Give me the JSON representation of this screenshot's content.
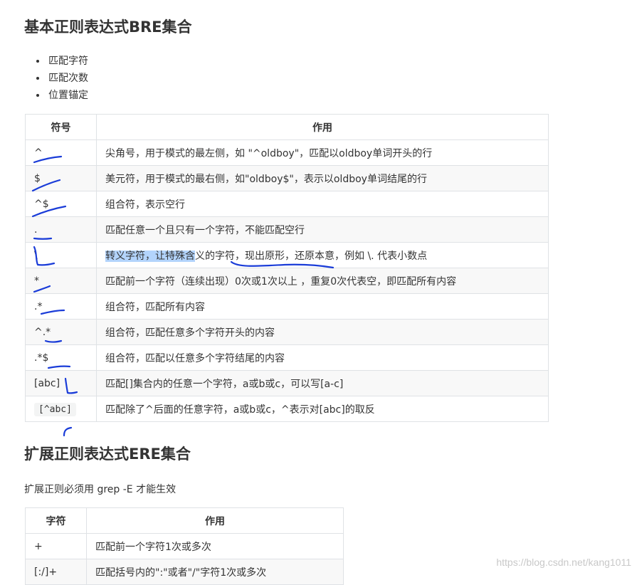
{
  "bre": {
    "title": "基本正则表达式BRE集合",
    "bullets": [
      "匹配字符",
      "匹配次数",
      "位置锚定"
    ],
    "headers": [
      "符号",
      "作用"
    ],
    "rows": [
      {
        "symbol": "^",
        "desc": "尖角号，用于模式的最左侧，如 \"^oldboy\"，匹配以oldboy单词开头的行"
      },
      {
        "symbol": "$",
        "desc": "美元符，用于模式的最右侧，如\"oldboy$\"，表示以oldboy单词结尾的行"
      },
      {
        "symbol": "^$",
        "desc": "组合符，表示空行"
      },
      {
        "symbol": ".",
        "desc": "匹配任意一个且只有一个字符，不能匹配空行"
      },
      {
        "symbol": "\\",
        "desc_highlight": "转义字符，让特殊含",
        "desc_rest": "义的字符，现出原形，还原本意，例如 \\. 代表小数点"
      },
      {
        "symbol": "*",
        "desc": "匹配前一个字符（连续出现）0次或1次以上 ，重复0次代表空，即匹配所有内容"
      },
      {
        "symbol": ".*",
        "desc": "组合符，匹配所有内容"
      },
      {
        "symbol": "^.*",
        "desc": "组合符，匹配任意多个字符开头的内容"
      },
      {
        "symbol": ".*$",
        "desc": "组合符，匹配以任意多个字符结尾的内容"
      },
      {
        "symbol": "[abc]",
        "desc": "匹配[]集合内的任意一个字符，a或b或c，可以写[a-c]"
      },
      {
        "symbol": "[^abc]",
        "desc": "匹配除了^后面的任意字符，a或b或c，^表示对[abc]的取反"
      }
    ]
  },
  "ere": {
    "title": "扩展正则表达式ERE集合",
    "note": "扩展正则必须用 grep -E 才能生效",
    "headers": [
      "字符",
      "作用"
    ],
    "rows": [
      {
        "symbol": "+",
        "desc": "匹配前一个字符1次或多次"
      },
      {
        "symbol": "[:/]+",
        "desc": "匹配括号内的\":\"或者\"/\"字符1次或多次"
      }
    ]
  },
  "watermark": "https://blog.csdn.net/kang1011",
  "colors": {
    "ink": "#1a3cd8",
    "highlight": "#b3d4fc",
    "border": "#dfe2e5"
  }
}
